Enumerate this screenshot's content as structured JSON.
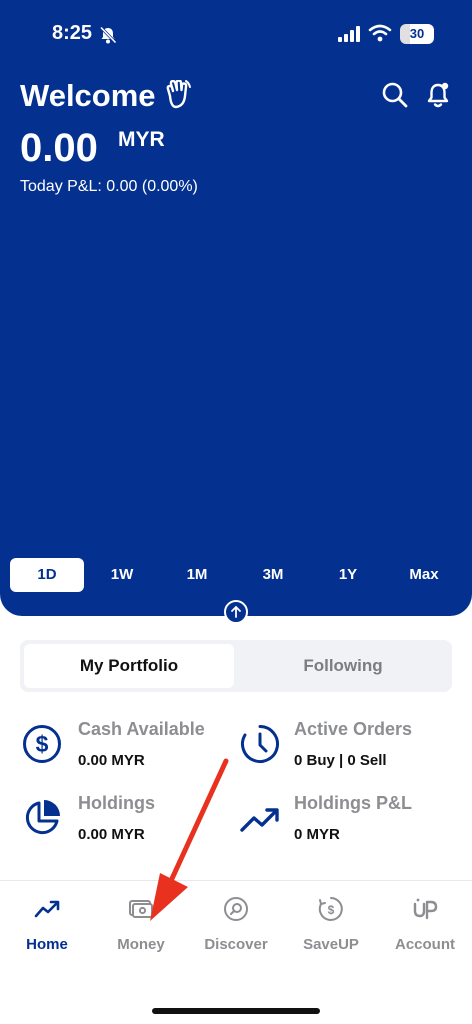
{
  "status_bar": {
    "time": "8:25",
    "battery": "30"
  },
  "header": {
    "greeting": "Welcome",
    "balance": "0.00",
    "currency": "MYR",
    "pnl": "Today P&L: 0.00 (0.00%)"
  },
  "range_selector": {
    "items": [
      "1D",
      "1W",
      "1M",
      "3M",
      "1Y",
      "Max"
    ],
    "selected": "1D"
  },
  "portfolio_tabs": {
    "items": [
      "My Portfolio",
      "Following"
    ],
    "selected": "My Portfolio"
  },
  "stats": {
    "cash_available": {
      "label": "Cash Available",
      "value": "0.00 MYR"
    },
    "active_orders": {
      "label": "Active Orders",
      "value": "0 Buy | 0 Sell"
    },
    "holdings": {
      "label": "Holdings",
      "value": "0.00 MYR"
    },
    "holdings_pnl": {
      "label": "Holdings P&L",
      "value": "0 MYR"
    }
  },
  "bottom_nav": {
    "items": [
      {
        "label": "Home",
        "icon": "trend-up-icon"
      },
      {
        "label": "Money",
        "icon": "wallet-icon"
      },
      {
        "label": "Discover",
        "icon": "discover-icon"
      },
      {
        "label": "SaveUP",
        "icon": "saveup-icon"
      },
      {
        "label": "Account",
        "icon": "account-icon"
      }
    ],
    "selected": "Home"
  },
  "colors": {
    "brand": "#04318f",
    "muted": "#8d8e92",
    "annotation_arrow": "#e8321f"
  }
}
